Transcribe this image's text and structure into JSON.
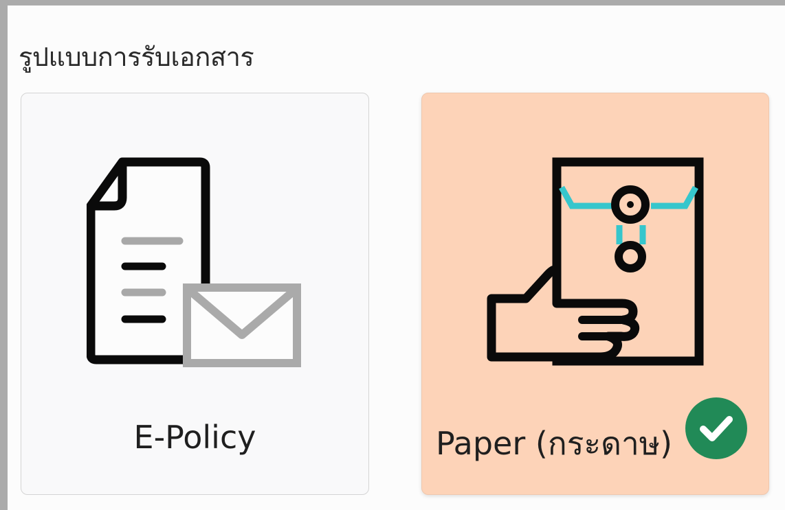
{
  "section": {
    "title": "รูปแบบการรับเอกสาร"
  },
  "options": [
    {
      "label": "E-Policy",
      "icon": "document-email-icon",
      "selected": false
    },
    {
      "label": "Paper (กระดาษ)",
      "icon": "hand-holding-envelope-icon",
      "selected": true
    }
  ],
  "colors": {
    "selected_card": "#fdd3b8",
    "unselected_card": "#f9f9fa",
    "check_badge": "#218a57",
    "envelope_string": "#36c6cc"
  },
  "badge": {
    "icon": "checkmark-icon"
  }
}
